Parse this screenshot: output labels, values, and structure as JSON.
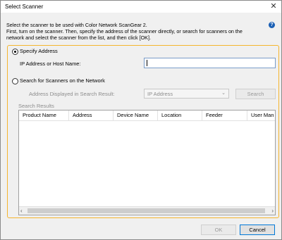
{
  "window": {
    "title": "Select Scanner",
    "close_glyph": "✕"
  },
  "intro": "Select the scanner to be used with Color Network ScanGear 2.\nFirst, turn on the scanner. Then, specify the address of the scanner directly, or search for scanners on the network and select the scanner from the list, and then click [OK].",
  "help_glyph": "?",
  "specify": {
    "label": "Specify Address",
    "selected": true,
    "ip_label": "IP Address or Host Name:",
    "ip_value": ""
  },
  "search_network": {
    "label": "Search for Scanners on the Network",
    "selected": false,
    "display_label": "Address Displayed in Search Result:",
    "display_value": "IP Address",
    "search_button": "Search",
    "results_label": "Search Results"
  },
  "results_table": {
    "columns": [
      "Product Name",
      "Address",
      "Device Name",
      "Location",
      "Feeder",
      "User Man"
    ],
    "rows": []
  },
  "buttons": {
    "ok": "OK",
    "cancel": "Cancel"
  },
  "colors": {
    "highlight": "#f5b52e",
    "help_icon": "#1a5fb4"
  }
}
